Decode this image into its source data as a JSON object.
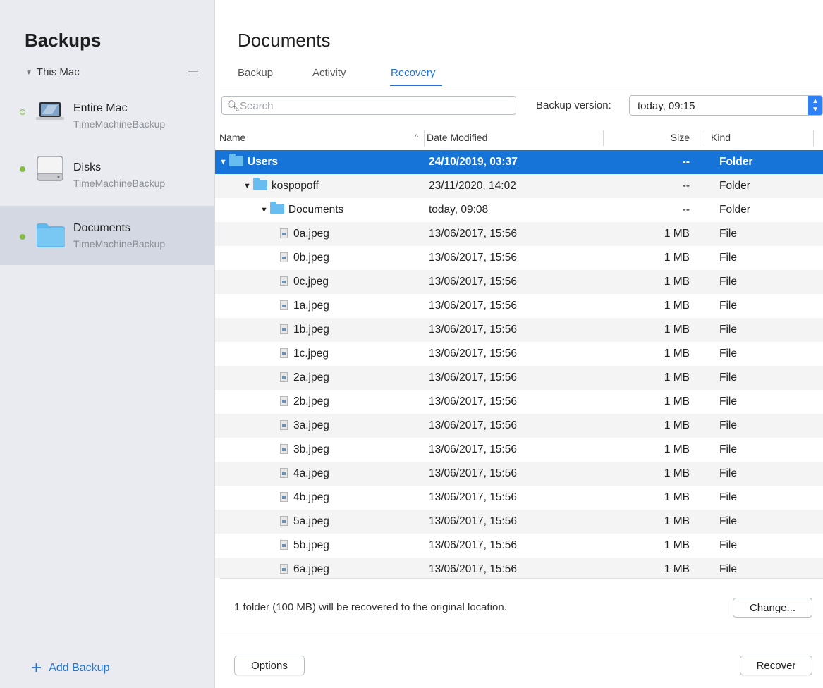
{
  "sidebar": {
    "title": "Backups",
    "group_label": "This Mac",
    "items": [
      {
        "name": "Entire Mac",
        "destination": "TimeMachineBackup",
        "status": "hollow",
        "icon": "laptop-icon"
      },
      {
        "name": "Disks",
        "destination": "TimeMachineBackup",
        "status": "filled",
        "icon": "disk-icon"
      },
      {
        "name": "Documents",
        "destination": "TimeMachineBackup",
        "status": "filled",
        "icon": "folder-icon",
        "selected": true
      }
    ],
    "add_backup_label": "Add Backup"
  },
  "main": {
    "title": "Documents",
    "tabs": [
      {
        "label": "Backup",
        "active": false
      },
      {
        "label": "Activity",
        "active": false
      },
      {
        "label": "Recovery",
        "active": true
      }
    ],
    "search": {
      "placeholder": "Search",
      "value": ""
    },
    "backup_version": {
      "label": "Backup version:",
      "value": "today, 09:15"
    }
  },
  "table": {
    "columns": {
      "name": "Name",
      "date": "Date Modified",
      "size": "Size",
      "kind": "Kind"
    },
    "sort_indicator": "^",
    "rows": [
      {
        "name": "Users",
        "date": "24/10/2019, 03:37",
        "size": "--",
        "kind": "Folder",
        "type": "folder",
        "level": 0,
        "selected": true
      },
      {
        "name": "kospopoff",
        "date": "23/11/2020, 14:02",
        "size": "--",
        "kind": "Folder",
        "type": "folder",
        "level": 1
      },
      {
        "name": "Documents",
        "date": "today, 09:08",
        "size": "--",
        "kind": "Folder",
        "type": "folder",
        "level": 2
      },
      {
        "name": "0a.jpeg",
        "date": "13/06/2017, 15:56",
        "size": "1 MB",
        "kind": "File",
        "type": "file",
        "level": 3
      },
      {
        "name": "0b.jpeg",
        "date": "13/06/2017, 15:56",
        "size": "1 MB",
        "kind": "File",
        "type": "file",
        "level": 3
      },
      {
        "name": "0c.jpeg",
        "date": "13/06/2017, 15:56",
        "size": "1 MB",
        "kind": "File",
        "type": "file",
        "level": 3
      },
      {
        "name": "1a.jpeg",
        "date": "13/06/2017, 15:56",
        "size": "1 MB",
        "kind": "File",
        "type": "file",
        "level": 3
      },
      {
        "name": "1b.jpeg",
        "date": "13/06/2017, 15:56",
        "size": "1 MB",
        "kind": "File",
        "type": "file",
        "level": 3
      },
      {
        "name": "1c.jpeg",
        "date": "13/06/2017, 15:56",
        "size": "1 MB",
        "kind": "File",
        "type": "file",
        "level": 3
      },
      {
        "name": "2a.jpeg",
        "date": "13/06/2017, 15:56",
        "size": "1 MB",
        "kind": "File",
        "type": "file",
        "level": 3
      },
      {
        "name": "2b.jpeg",
        "date": "13/06/2017, 15:56",
        "size": "1 MB",
        "kind": "File",
        "type": "file",
        "level": 3
      },
      {
        "name": "3a.jpeg",
        "date": "13/06/2017, 15:56",
        "size": "1 MB",
        "kind": "File",
        "type": "file",
        "level": 3
      },
      {
        "name": "3b.jpeg",
        "date": "13/06/2017, 15:56",
        "size": "1 MB",
        "kind": "File",
        "type": "file",
        "level": 3
      },
      {
        "name": "4a.jpeg",
        "date": "13/06/2017, 15:56",
        "size": "1 MB",
        "kind": "File",
        "type": "file",
        "level": 3
      },
      {
        "name": "4b.jpeg",
        "date": "13/06/2017, 15:56",
        "size": "1 MB",
        "kind": "File",
        "type": "file",
        "level": 3
      },
      {
        "name": "5a.jpeg",
        "date": "13/06/2017, 15:56",
        "size": "1 MB",
        "kind": "File",
        "type": "file",
        "level": 3
      },
      {
        "name": "5b.jpeg",
        "date": "13/06/2017, 15:56",
        "size": "1 MB",
        "kind": "File",
        "type": "file",
        "level": 3
      },
      {
        "name": "6a.jpeg",
        "date": "13/06/2017, 15:56",
        "size": "1 MB",
        "kind": "File",
        "type": "file",
        "level": 3
      }
    ]
  },
  "footer": {
    "info": "1 folder (100 MB) will be recovered to the original location.",
    "change_label": "Change...",
    "options_label": "Options",
    "recover_label": "Recover"
  },
  "colors": {
    "accent": "#1e73d6",
    "selection": "#1673d8",
    "status_green": "#86bd4a",
    "sidebar_bg": "#e9ebf0"
  }
}
